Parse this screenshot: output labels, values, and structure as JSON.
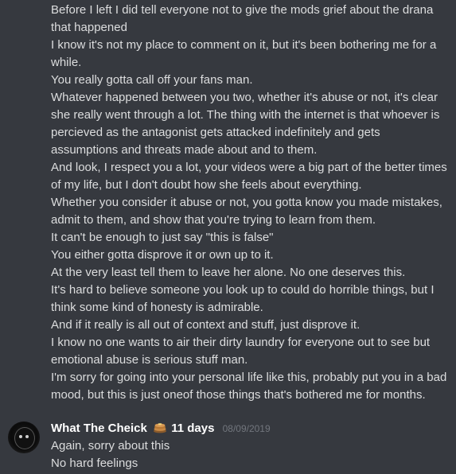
{
  "previous_message": {
    "lines": [
      "Before I left I did tell everyone not to give the mods grief about the drana that happened",
      "I know it's not my place to comment on it, but it's been bothering me for a while.",
      "You really gotta call off your fans man.",
      "Whatever happened between you two, whether it's abuse or not, it's clear she really went through a lot. The thing with the internet is that whoever is percieved as the antagonist gets attacked indefinitely and gets assumptions and threats made about and to them.",
      "And look, I respect you a lot, your videos were a big part of the better times of my life, but I don't doubt how she feels about everything.",
      "Whether you consider it abuse or not, you gotta know you made mistakes, admit to them, and show that you're trying to learn from them.",
      "It can't be enough to just say \"this is false\"",
      "You either gotta disprove it or own up to it.",
      "At the very least tell them to leave her alone. No one deserves this.",
      "It's hard to believe someone you look up to could do horrible things, but I think some kind of honesty is admirable.",
      "And if it really is all out of context and stuff, just disprove it.",
      "I know no one wants to air their dirty laundry for everyone out to see but emotional abuse is serious stuff man.",
      "I'm sorry for going into your personal life like this, probably put you in a bad mood, but this is just oneof those things that's bothered me for months."
    ]
  },
  "reply": {
    "username": "What The Cheick",
    "badge_icon": "pancake-emoji-icon",
    "status_text": "11 days",
    "timestamp": "08/09/2019",
    "lines": [
      "Again, sorry about this",
      "No hard feelings"
    ]
  },
  "colors": {
    "background": "#36393f",
    "text": "#dcddde",
    "username": "#ffffff",
    "timestamp": "#72767d"
  }
}
